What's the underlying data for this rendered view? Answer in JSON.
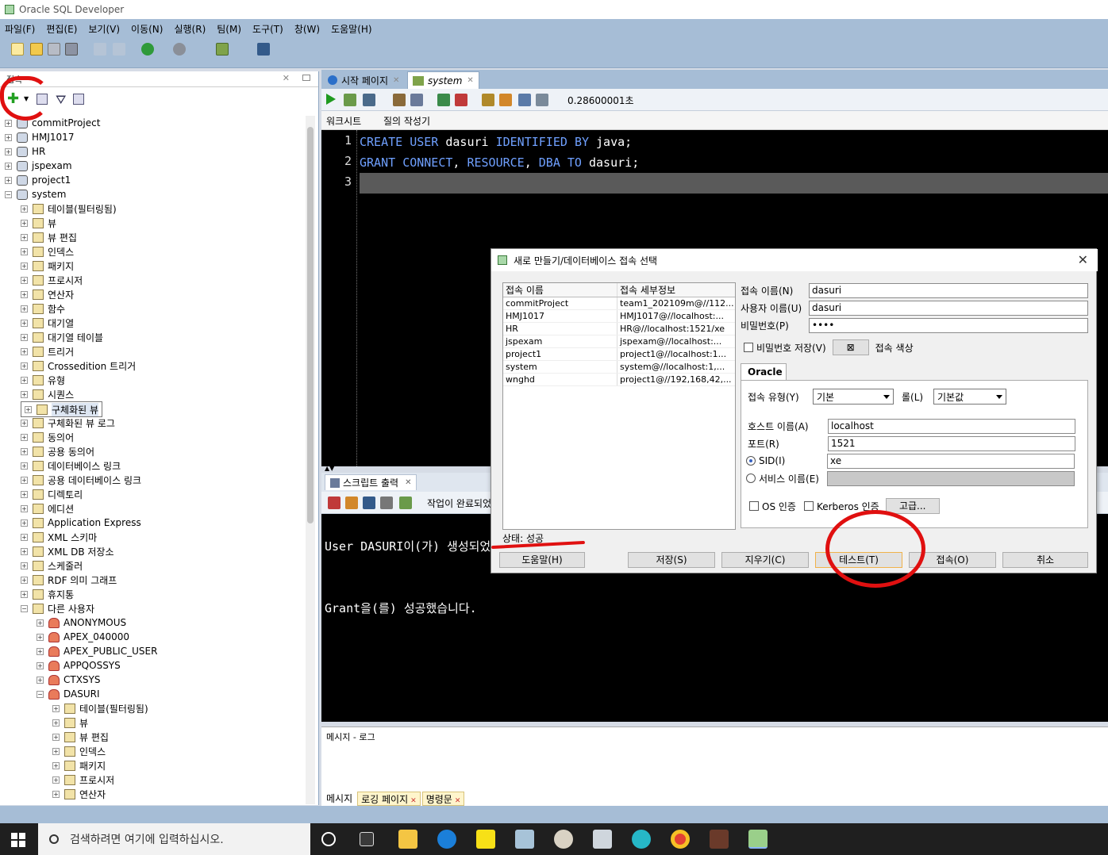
{
  "app": {
    "title": "Oracle SQL Developer"
  },
  "menu": [
    "파일(F)",
    "편집(E)",
    "보기(V)",
    "이동(N)",
    "실행(R)",
    "팀(M)",
    "도구(T)",
    "창(W)",
    "도움말(H)"
  ],
  "left_panel": {
    "tab_label": "접속",
    "tree": [
      {
        "label": "commitProject",
        "level": 0,
        "expanded": false,
        "icon": "db"
      },
      {
        "label": "HMJ1017",
        "level": 0,
        "expanded": false,
        "icon": "db"
      },
      {
        "label": "HR",
        "level": 0,
        "expanded": false,
        "icon": "db"
      },
      {
        "label": "jspexam",
        "level": 0,
        "expanded": false,
        "icon": "db-conn"
      },
      {
        "label": "project1",
        "level": 0,
        "expanded": false,
        "icon": "db-conn"
      },
      {
        "label": "system",
        "level": 0,
        "expanded": true,
        "icon": "db-conn"
      },
      {
        "label": "테이블(필터링됨)",
        "level": 1,
        "expanded": false,
        "icon": "folder"
      },
      {
        "label": "뷰",
        "level": 1,
        "expanded": false,
        "icon": "folder"
      },
      {
        "label": "뷰 편집",
        "level": 1,
        "expanded": false,
        "icon": "folder"
      },
      {
        "label": "인덱스",
        "level": 1,
        "expanded": false,
        "icon": "folder"
      },
      {
        "label": "패키지",
        "level": 1,
        "expanded": false,
        "icon": "folder"
      },
      {
        "label": "프로시저",
        "level": 1,
        "expanded": false,
        "icon": "folder"
      },
      {
        "label": "연산자",
        "level": 1,
        "expanded": false,
        "icon": "folder"
      },
      {
        "label": "함수",
        "level": 1,
        "expanded": false,
        "icon": "folder"
      },
      {
        "label": "대기열",
        "level": 1,
        "expanded": false,
        "icon": "folder"
      },
      {
        "label": "대기열 테이블",
        "level": 1,
        "expanded": false,
        "icon": "folder"
      },
      {
        "label": "트리거",
        "level": 1,
        "expanded": false,
        "icon": "folder"
      },
      {
        "label": "Crossedition 트리거",
        "level": 1,
        "expanded": false,
        "icon": "folder"
      },
      {
        "label": "유형",
        "level": 1,
        "expanded": false,
        "icon": "folder"
      },
      {
        "label": "시퀀스",
        "level": 1,
        "expanded": false,
        "icon": "folder"
      },
      {
        "label": "구체화된 뷰",
        "level": 1,
        "expanded": false,
        "icon": "folder",
        "selected": true
      },
      {
        "label": "구체화된 뷰 로그",
        "level": 1,
        "expanded": false,
        "icon": "folder"
      },
      {
        "label": "동의어",
        "level": 1,
        "expanded": false,
        "icon": "folder"
      },
      {
        "label": "공용 동의어",
        "level": 1,
        "expanded": false,
        "icon": "folder"
      },
      {
        "label": "데이터베이스 링크",
        "level": 1,
        "expanded": false,
        "icon": "folder"
      },
      {
        "label": "공용 데이터베이스 링크",
        "level": 1,
        "expanded": false,
        "icon": "folder"
      },
      {
        "label": "디렉토리",
        "level": 1,
        "expanded": false,
        "icon": "folder"
      },
      {
        "label": "에디션",
        "level": 1,
        "expanded": false,
        "icon": "folder"
      },
      {
        "label": "Application Express",
        "level": 1,
        "expanded": false,
        "icon": "folder"
      },
      {
        "label": "XML 스키마",
        "level": 1,
        "expanded": false,
        "icon": "folder"
      },
      {
        "label": "XML DB 저장소",
        "level": 1,
        "expanded": false,
        "icon": "folder"
      },
      {
        "label": "스케줄러",
        "level": 1,
        "expanded": false,
        "icon": "folder"
      },
      {
        "label": "RDF 의미 그래프",
        "level": 1,
        "expanded": false,
        "icon": "folder"
      },
      {
        "label": "휴지통",
        "level": 1,
        "expanded": false,
        "icon": "folder"
      },
      {
        "label": "다른 사용자",
        "level": 1,
        "expanded": true,
        "icon": "folder"
      },
      {
        "label": "ANONYMOUS",
        "level": 2,
        "expanded": false,
        "icon": "user"
      },
      {
        "label": "APEX_040000",
        "level": 2,
        "expanded": false,
        "icon": "user"
      },
      {
        "label": "APEX_PUBLIC_USER",
        "level": 2,
        "expanded": false,
        "icon": "user"
      },
      {
        "label": "APPQOSSYS",
        "level": 2,
        "expanded": false,
        "icon": "user"
      },
      {
        "label": "CTXSYS",
        "level": 2,
        "expanded": false,
        "icon": "user"
      },
      {
        "label": "DASURI",
        "level": 2,
        "expanded": true,
        "icon": "user"
      },
      {
        "label": "테이블(필터링됨)",
        "level": 3,
        "expanded": false,
        "icon": "folder"
      },
      {
        "label": "뷰",
        "level": 3,
        "expanded": false,
        "icon": "folder"
      },
      {
        "label": "뷰 편집",
        "level": 3,
        "expanded": false,
        "icon": "folder"
      },
      {
        "label": "인덱스",
        "level": 3,
        "expanded": false,
        "icon": "folder"
      },
      {
        "label": "패키지",
        "level": 3,
        "expanded": false,
        "icon": "folder"
      },
      {
        "label": "프로시저",
        "level": 3,
        "expanded": false,
        "icon": "folder"
      },
      {
        "label": "연산자",
        "level": 3,
        "expanded": false,
        "icon": "folder"
      }
    ]
  },
  "editor": {
    "tabs": [
      {
        "label": "시작 페이지",
        "active": false
      },
      {
        "label": "system",
        "active": true
      }
    ],
    "timing": "0.28600001초",
    "subtabs": [
      "워크시트",
      "질의 작성기"
    ],
    "line_numbers": [
      "1",
      "2",
      "3"
    ],
    "code_lines": [
      "CREATE USER dasuri IDENTIFIED BY java;",
      "GRANT CONNECT, RESOURCE, DBA TO dasuri;",
      ""
    ]
  },
  "script_output": {
    "tab_label": "스크립트 출력",
    "status_msg": "작업이 완료되었",
    "lines": [
      "User DASURI이(가) 생성되었습니다.",
      "Grant을(를) 성공했습니다."
    ]
  },
  "message_log": {
    "header": "메시지 - 로그",
    "tabs": [
      "메시지",
      "로깅 페이지",
      "명령문"
    ]
  },
  "taskbar": {
    "search_placeholder": "검색하려면 여기에 입력하십시오."
  },
  "dialog": {
    "title": "새로 만들기/데이터베이스 접속 선택",
    "list_headers": [
      "접속 이름",
      "접속 세부정보"
    ],
    "connections": [
      {
        "name": "commitProject",
        "details": "team1_202109m@//112..."
      },
      {
        "name": "HMJ1017",
        "details": "HMJ1017@//localhost:..."
      },
      {
        "name": "HR",
        "details": "HR@//localhost:1521/xe"
      },
      {
        "name": "jspexam",
        "details": "jspexam@//localhost:..."
      },
      {
        "name": "project1",
        "details": "project1@//localhost:1..."
      },
      {
        "name": "system",
        "details": "system@//localhost:1,..."
      },
      {
        "name": "wnghd",
        "details": "project1@//192,168,42,..."
      }
    ],
    "status": "상태: 성공",
    "fields": {
      "conn_name_label": "접속 이름(N)",
      "conn_name": "dasuri",
      "user_label": "사용자 이름(U)",
      "user": "dasuri",
      "password_label": "비밀번호(P)",
      "password": "••••",
      "save_pw_label": "비밀번호 저장(V)",
      "color_label": "접속 색상",
      "oracle_tab": "Oracle",
      "conn_type_label": "접속 유형(Y)",
      "conn_type": "기본",
      "role_label": "롤(L)",
      "role": "기본값",
      "host_label": "호스트 이름(A)",
      "host": "localhost",
      "port_label": "포트(R)",
      "port": "1521",
      "sid_label": "SID(I)",
      "sid": "xe",
      "service_label": "서비스 이름(E)",
      "os_auth_label": "OS 인증",
      "kerberos_label": "Kerberos 인증",
      "advanced_label": "고급..."
    },
    "buttons": {
      "help": "도움말(H)",
      "save": "저장(S)",
      "clear": "지우기(C)",
      "test": "테스트(T)",
      "connect": "접속(O)",
      "cancel": "취소"
    }
  },
  "colors": {
    "chrome": "#a6bdd6",
    "keyword": "#6fa0ff",
    "annotation_red": "#e01010"
  }
}
